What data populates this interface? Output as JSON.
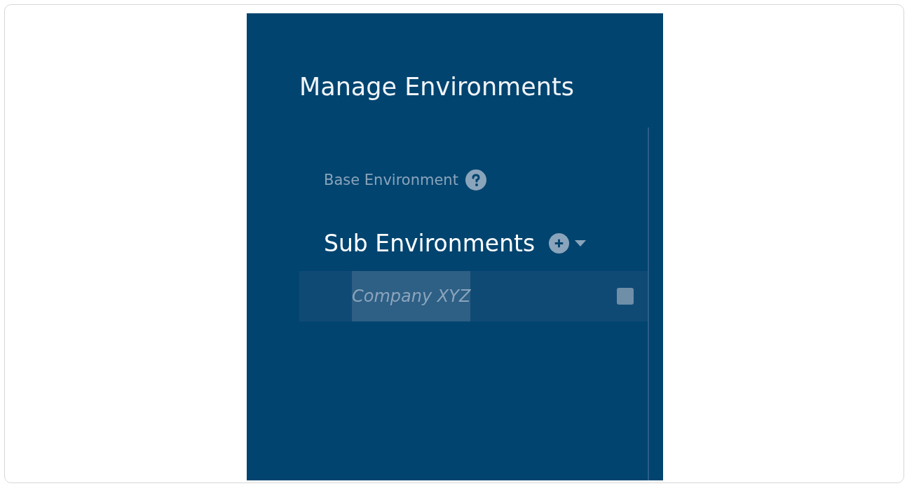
{
  "title": "Manage Environments",
  "base_environment": {
    "label": "Base Environment"
  },
  "sub_environments": {
    "heading": "Sub Environments",
    "items": [
      {
        "name": "Company XYZ",
        "selected": true,
        "checked": false
      }
    ]
  }
}
